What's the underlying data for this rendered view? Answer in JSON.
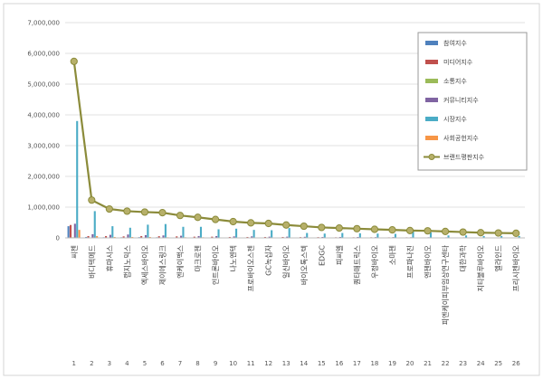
{
  "chart_data": {
    "type": "bar",
    "title": "",
    "xlabel": "",
    "ylabel": "",
    "ylim": [
      0,
      7000000
    ],
    "yticks": [
      "0",
      "1,000,000",
      "2,000,000",
      "3,000,000",
      "4,000,000",
      "5,000,000",
      "6,000,000",
      "7,000,000"
    ],
    "grid": true,
    "legend_position": "top-right",
    "numbers": [
      "1",
      "2",
      "3",
      "4",
      "5",
      "6",
      "7",
      "8",
      "9",
      "10",
      "11",
      "12",
      "13",
      "14",
      "15",
      "16",
      "17",
      "18",
      "19",
      "20",
      "21",
      "22",
      "23",
      "24",
      "25",
      "26"
    ],
    "categories": [
      "씨젠",
      "바디텍메드",
      "휴마시스",
      "랩지노믹스",
      "엑세스바이오",
      "제이에스링크",
      "엔케이맥스",
      "마크로젠",
      "인트론바이오",
      "나노엔텍",
      "프로바이오스젠",
      "GC녹십자",
      "일신바이오",
      "바이오톡스텍",
      "EDGC",
      "피씨엘",
      "퀀타매트릭스",
      "우정바이오",
      "소마젠",
      "프로파나진",
      "엔젠바이오",
      "피엔케이피부임상연구센타",
      "대한과학",
      "지티불루바이오",
      "엘라인드",
      "프리시젠바이오"
    ],
    "series": [
      {
        "name": "참여지수",
        "color": "#4f81bd",
        "values": [
          380000,
          30000,
          20000,
          20000,
          25000,
          20000,
          15000,
          15000,
          12000,
          10000,
          10000,
          10000,
          10000,
          8000,
          8000,
          6000,
          6000,
          6000,
          5000,
          5000,
          5000,
          4000,
          4000,
          4000,
          3000,
          3000
        ]
      },
      {
        "name": "미디어지수",
        "color": "#c0504d",
        "values": [
          420000,
          60000,
          60000,
          50000,
          60000,
          55000,
          50000,
          40000,
          40000,
          30000,
          30000,
          30000,
          30000,
          25000,
          25000,
          20000,
          20000,
          20000,
          18000,
          18000,
          15000,
          12000,
          12000,
          10000,
          10000,
          8000
        ]
      },
      {
        "name": "소통지수",
        "color": "#9bbb59",
        "values": [
          20000,
          8000,
          5000,
          5000,
          5000,
          5000,
          5000,
          4000,
          4000,
          3000,
          3000,
          3000,
          3000,
          3000,
          3000,
          2000,
          2000,
          2000,
          2000,
          2000,
          2000,
          2000,
          2000,
          2000,
          2000,
          2000
        ]
      },
      {
        "name": "커뮤니티지수",
        "color": "#8064a2",
        "values": [
          460000,
          120000,
          100000,
          110000,
          90000,
          80000,
          70000,
          60000,
          60000,
          50000,
          50000,
          40000,
          40000,
          35000,
          30000,
          30000,
          30000,
          25000,
          25000,
          20000,
          20000,
          18000,
          18000,
          15000,
          15000,
          12000
        ]
      },
      {
        "name": "시장지수",
        "color": "#4bacc6",
        "values": [
          3800000,
          870000,
          380000,
          330000,
          430000,
          450000,
          360000,
          360000,
          280000,
          300000,
          260000,
          250000,
          320000,
          160000,
          140000,
          160000,
          150000,
          140000,
          130000,
          220000,
          180000,
          80000,
          80000,
          60000,
          60000,
          60000
        ]
      },
      {
        "name": "사회공헌지수",
        "color": "#f79646",
        "values": [
          260000,
          60000,
          30000,
          30000,
          30000,
          20000,
          20000,
          20000,
          15000,
          15000,
          15000,
          15000,
          15000,
          10000,
          10000,
          10000,
          10000,
          10000,
          10000,
          10000,
          10000,
          10000,
          10000,
          10000,
          10000,
          10000
        ]
      }
    ],
    "line_series": {
      "name": "브랜드평판지수",
      "color": "#8b8b3a",
      "marker_color": "#b7b06a",
      "values": [
        5740000,
        1230000,
        940000,
        870000,
        840000,
        820000,
        730000,
        670000,
        600000,
        530000,
        490000,
        470000,
        420000,
        380000,
        340000,
        320000,
        300000,
        280000,
        260000,
        240000,
        230000,
        210000,
        190000,
        170000,
        160000,
        150000
      ]
    }
  }
}
